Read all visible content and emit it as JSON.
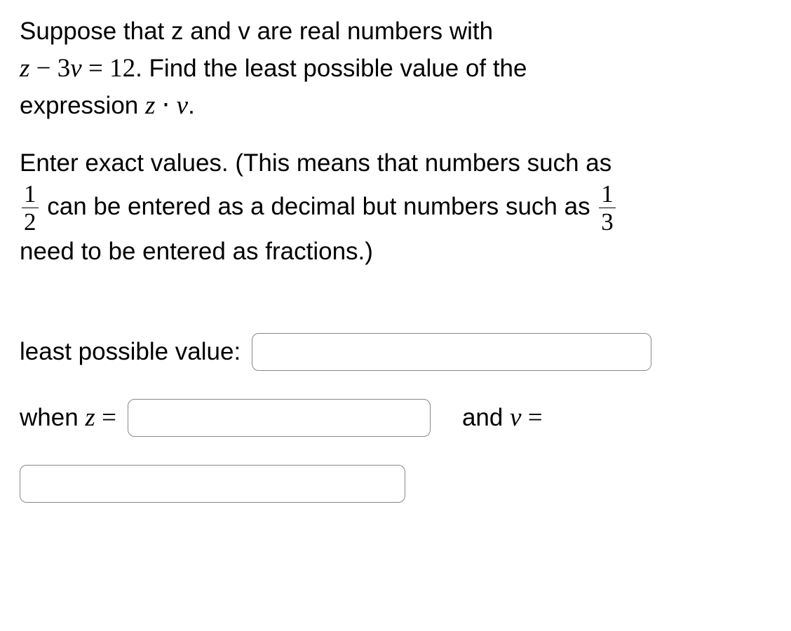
{
  "problem": {
    "line1_prefix": "Suppose that z  and v are real numbers with",
    "equation_z": "z",
    "equation_minus": " − ",
    "equation_3": "3",
    "equation_v": "v",
    "equation_eq": " = ",
    "equation_12": "12",
    "equation_period": ".  ",
    "line2_suffix": "Find the least possible value of the",
    "line3_prefix": "expression ",
    "expr_z": "z",
    "expr_dot": " ⋅ ",
    "expr_v": "v",
    "expr_period": "."
  },
  "instruction": {
    "line1": "Enter exact values.  (This means that numbers such as",
    "frac1_num": "1",
    "frac1_den": "2",
    "line2_mid": " can be entered as a decimal but numbers such as ",
    "frac2_num": "1",
    "frac2_den": "3",
    "line3": "need to be entered as  fractions.)"
  },
  "answers": {
    "lpv_label": "least possible value:",
    "when_label": "when ",
    "z_var": "z",
    "eq": " = ",
    "and_label": "and ",
    "v_var": "v",
    "lpv_value": "",
    "z_value": "",
    "v_value": ""
  }
}
